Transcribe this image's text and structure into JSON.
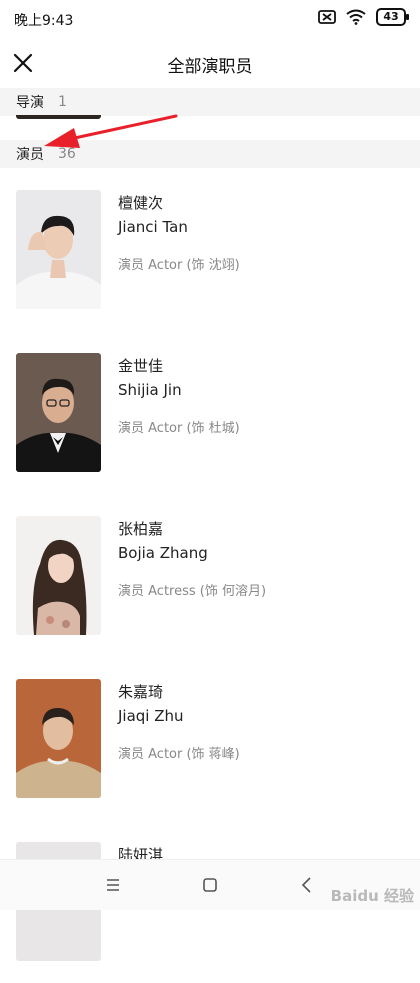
{
  "status_bar": {
    "time": "晚上9:43",
    "battery": "43"
  },
  "header": {
    "title": "全部演职员"
  },
  "sections": {
    "director": {
      "title": "导演",
      "count": "1"
    },
    "actors": {
      "title": "演员",
      "count": "36"
    }
  },
  "cast": [
    {
      "name_zh": "檀健次",
      "name_en": "Jianci Tan",
      "role": "演员 Actor (饰 沈翊)"
    },
    {
      "name_zh": "金世佳",
      "name_en": "Shijia Jin",
      "role": "演员 Actor (饰 杜城)"
    },
    {
      "name_zh": "张柏嘉",
      "name_en": "Bojia Zhang",
      "role": "演员 Actress (饰 何溶月)"
    },
    {
      "name_zh": "朱嘉琦",
      "name_en": "Jiaqi Zhu",
      "role": "演员 Actor (饰 蒋峰)"
    },
    {
      "name_zh": "陆妍淇",
      "name_en": "",
      "role": ""
    }
  ],
  "watermark": "Baidu 经验",
  "colors": {
    "annotation_arrow": "#e8202a",
    "section_bg": "#f4f4f4"
  }
}
